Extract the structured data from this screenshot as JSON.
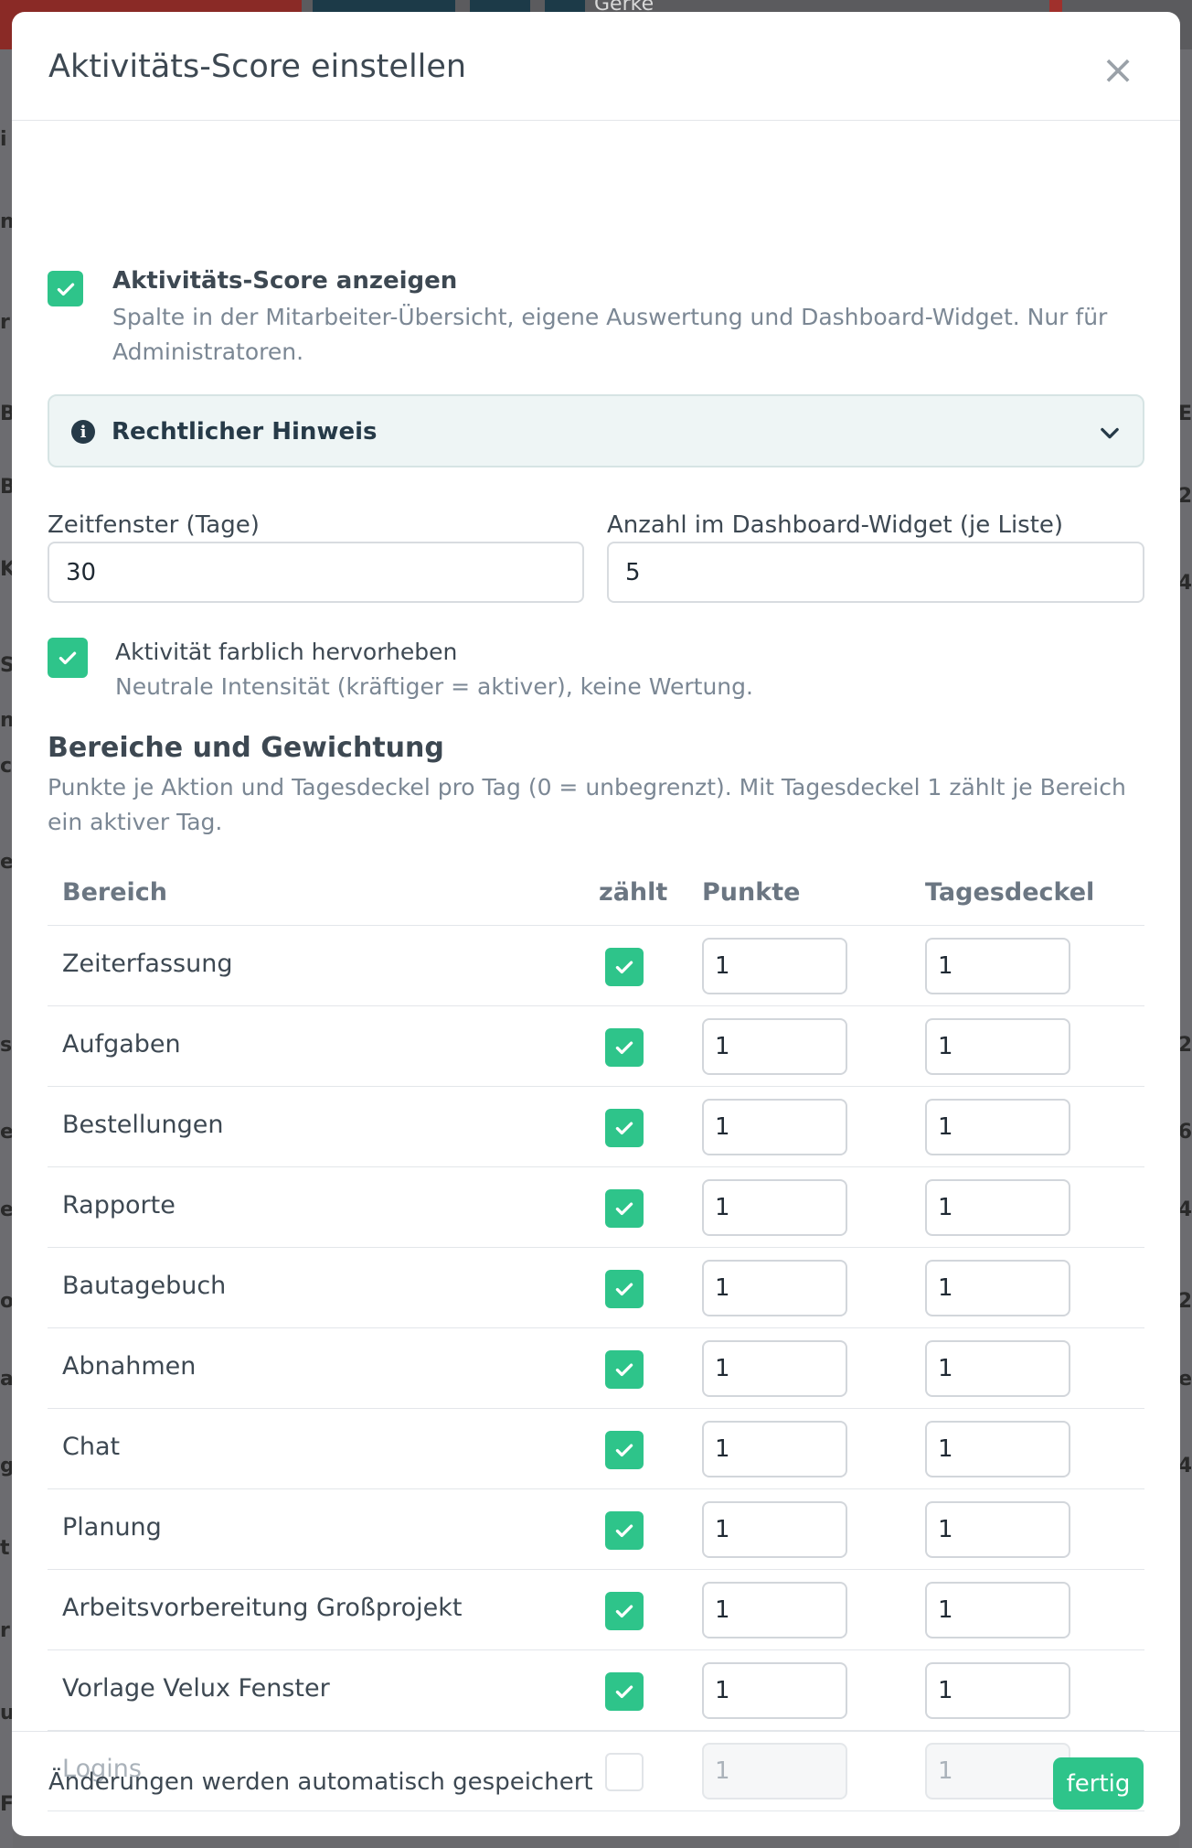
{
  "background": {
    "user_name": "Gerke",
    "left_glyphs": [
      "i",
      "n",
      "r",
      "B",
      "B",
      "K",
      "S",
      "n",
      "cl",
      "e",
      "s",
      "e",
      "el",
      "o",
      "a",
      "g",
      "t",
      "r",
      "u",
      "F"
    ],
    "right_glyphs": [
      "E",
      "2",
      "4",
      "2",
      "6",
      "4",
      "2",
      "e",
      "4"
    ]
  },
  "modal": {
    "title": "Aktivitäts-Score einstellen",
    "close_label": "×",
    "show_score": {
      "checked": true,
      "title": "Aktivitäts-Score anzeigen",
      "description": "Spalte in der Mitarbeiter-Übersicht, eigene Auswertung und Dashboard-Widget. Nur für Administratoren."
    },
    "legal_notice": {
      "label": "Rechtlicher Hinweis",
      "icon": "info-icon",
      "expanded": false
    },
    "time_window": {
      "label": "Zeitfenster (Tage)",
      "value": "30"
    },
    "widget_count": {
      "label": "Anzahl im Dashboard-Widget (je Liste)",
      "value": "5"
    },
    "highlight": {
      "checked": true,
      "title": "Aktivität farblich hervorheben",
      "description": "Neutrale Intensität (kräftiger = aktiver), keine Wertung."
    },
    "areas": {
      "title": "Bereiche und Gewichtung",
      "description": "Punkte je Aktion und Tagesdeckel pro Tag (0 = unbegrenzt). Mit Tagesdeckel 1 zählt je Bereich ein aktiver Tag.",
      "columns": {
        "area": "Bereich",
        "counts": "zählt",
        "points": "Punkte",
        "cap": "Tagesdeckel"
      },
      "rows": [
        {
          "name": "Zeiterfassung",
          "counts": true,
          "points": "1",
          "cap": "1"
        },
        {
          "name": "Aufgaben",
          "counts": true,
          "points": "1",
          "cap": "1"
        },
        {
          "name": "Bestellungen",
          "counts": true,
          "points": "1",
          "cap": "1"
        },
        {
          "name": "Rapporte",
          "counts": true,
          "points": "1",
          "cap": "1"
        },
        {
          "name": "Bautagebuch",
          "counts": true,
          "points": "1",
          "cap": "1"
        },
        {
          "name": "Abnahmen",
          "counts": true,
          "points": "1",
          "cap": "1"
        },
        {
          "name": "Chat",
          "counts": true,
          "points": "1",
          "cap": "1"
        },
        {
          "name": "Planung",
          "counts": true,
          "points": "1",
          "cap": "1"
        },
        {
          "name": "Arbeitsvorbereitung Großprojekt",
          "counts": true,
          "points": "1",
          "cap": "1"
        },
        {
          "name": "Vorlage Velux Fenster",
          "counts": true,
          "points": "1",
          "cap": "1"
        },
        {
          "name": "Logins",
          "counts": false,
          "points": "1",
          "cap": "1"
        }
      ]
    },
    "footer": {
      "note": "Änderungen werden automatisch gespeichert",
      "done_label": "fertig"
    }
  },
  "colors": {
    "accent": "#2ec48a",
    "title_text": "#3d4852",
    "muted_text": "#7b8794",
    "legal_bg": "#eef5f5"
  }
}
